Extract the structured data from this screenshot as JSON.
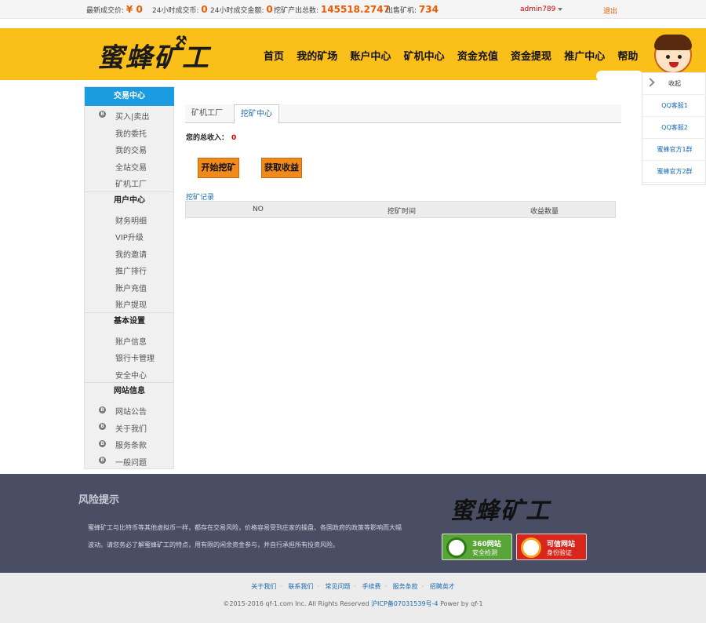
{
  "topbar": {
    "latest_price_label": "最新成交价:",
    "latest_price_value": "¥ 0",
    "vol24_label": "24小时成交币:",
    "vol24_value": "0",
    "amount24_label": "24小时成交金额:",
    "amount24_value": "0",
    "mined_label": "挖矿产出总数:",
    "mined_value": "145518.2747",
    "sold_label": "出售矿机:",
    "sold_value": "734",
    "username": "admin789",
    "logout": "退出"
  },
  "header": {
    "logo": "蜜蜂矿工",
    "nav": [
      "首页",
      "我的矿场",
      "账户中心",
      "矿机中心",
      "资金充值",
      "资金提现",
      "推广中心",
      "帮助"
    ]
  },
  "float_panel": {
    "collapse": "收起",
    "items": [
      "QQ客服1",
      "QQ客服2",
      "蜜蜂官方1群",
      "蜜蜂官方2群"
    ]
  },
  "sidebar": {
    "trade_center": "交易中心",
    "trade_items": [
      "买入|卖出",
      "我的委托",
      "我的交易",
      "全站交易",
      "矿机工厂"
    ],
    "user_center": "用户中心",
    "user_items": [
      "财务明细",
      "VIP升级",
      "我的邀请",
      "推广排行",
      "账户充值",
      "账户提现"
    ],
    "basic_settings": "基本设置",
    "basic_items": [
      "账户信息",
      "银行卡管理",
      "安全中心"
    ],
    "site_info": "网站信息",
    "site_items": [
      "网站公告",
      "关于我们",
      "服务条款",
      "一般问题"
    ]
  },
  "main": {
    "tabs": [
      "矿机工厂",
      "挖矿中心"
    ],
    "income_label": "您的总收入：",
    "income_value": "0",
    "start_button": "开始挖矿",
    "collect_button": "获取收益",
    "records_label": "挖矿记录",
    "columns": [
      "NO",
      "挖矿时间",
      "收益数量"
    ]
  },
  "footer": {
    "risk_title": "风险提示",
    "risk_line1": "蜜蜂矿工与比特币等其他虚拟币一样，都存在交易风险，价格容易受到庄家的操盘、各国政府的政策等影响而大幅",
    "risk_line2": "波动。请您务必了解蜜蜂矿工的特点，用有限的闲余资金参与，并自行承担所有投资风险。",
    "logo": "蜜蜂矿工",
    "badge1_title": "360网站",
    "badge1_sub": "安全检测",
    "badge2_title": "可信网站",
    "badge2_sub": "身份验证",
    "links": [
      "关于我们",
      "联系我们",
      "常见问题",
      "手续费",
      "服务条款",
      "招聘英才"
    ],
    "copyright": "©2015-2016 qf-1.com Inc. All Rights Reserved",
    "icp": "沪ICP备07031539号-4",
    "powered": "Power by qf-1"
  },
  "colors": {
    "header_yellow": "#fbbf1a",
    "sidebar_active": "#1b9ce0",
    "button_orange": "#f08a1c",
    "footer_dark": "#4a4e65"
  }
}
